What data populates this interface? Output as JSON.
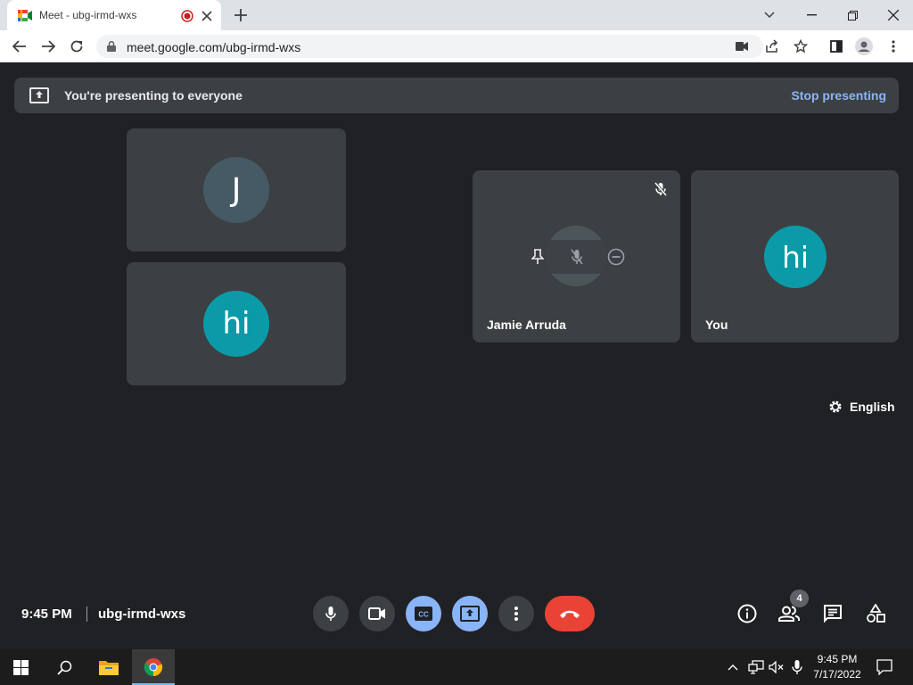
{
  "browser": {
    "tab_title": "Meet - ubg-irmd-wxs",
    "url": "meet.google.com/ubg-irmd-wxs"
  },
  "banner": {
    "message": "You're presenting to everyone",
    "stop_label": "Stop presenting"
  },
  "tiles": [
    {
      "initial": "J",
      "avatar_color": "#455a64"
    },
    {
      "initial": "hi",
      "avatar_color": "#0b9aa8"
    },
    {
      "name": "Jamie Arruda"
    },
    {
      "name": "You",
      "initial": "hi",
      "avatar_color": "#0b9aa8"
    }
  ],
  "captions_language": "English",
  "meeting": {
    "time": "9:45 PM",
    "code": "ubg-irmd-wxs",
    "participant_count": "4"
  },
  "colors": {
    "meet_bg": "#202124",
    "tile_bg": "#3c4043",
    "accent_blue": "#8ab4f8",
    "end_call_red": "#ea4335"
  },
  "taskbar": {
    "time": "9:45 PM",
    "date": "7/17/2022"
  }
}
